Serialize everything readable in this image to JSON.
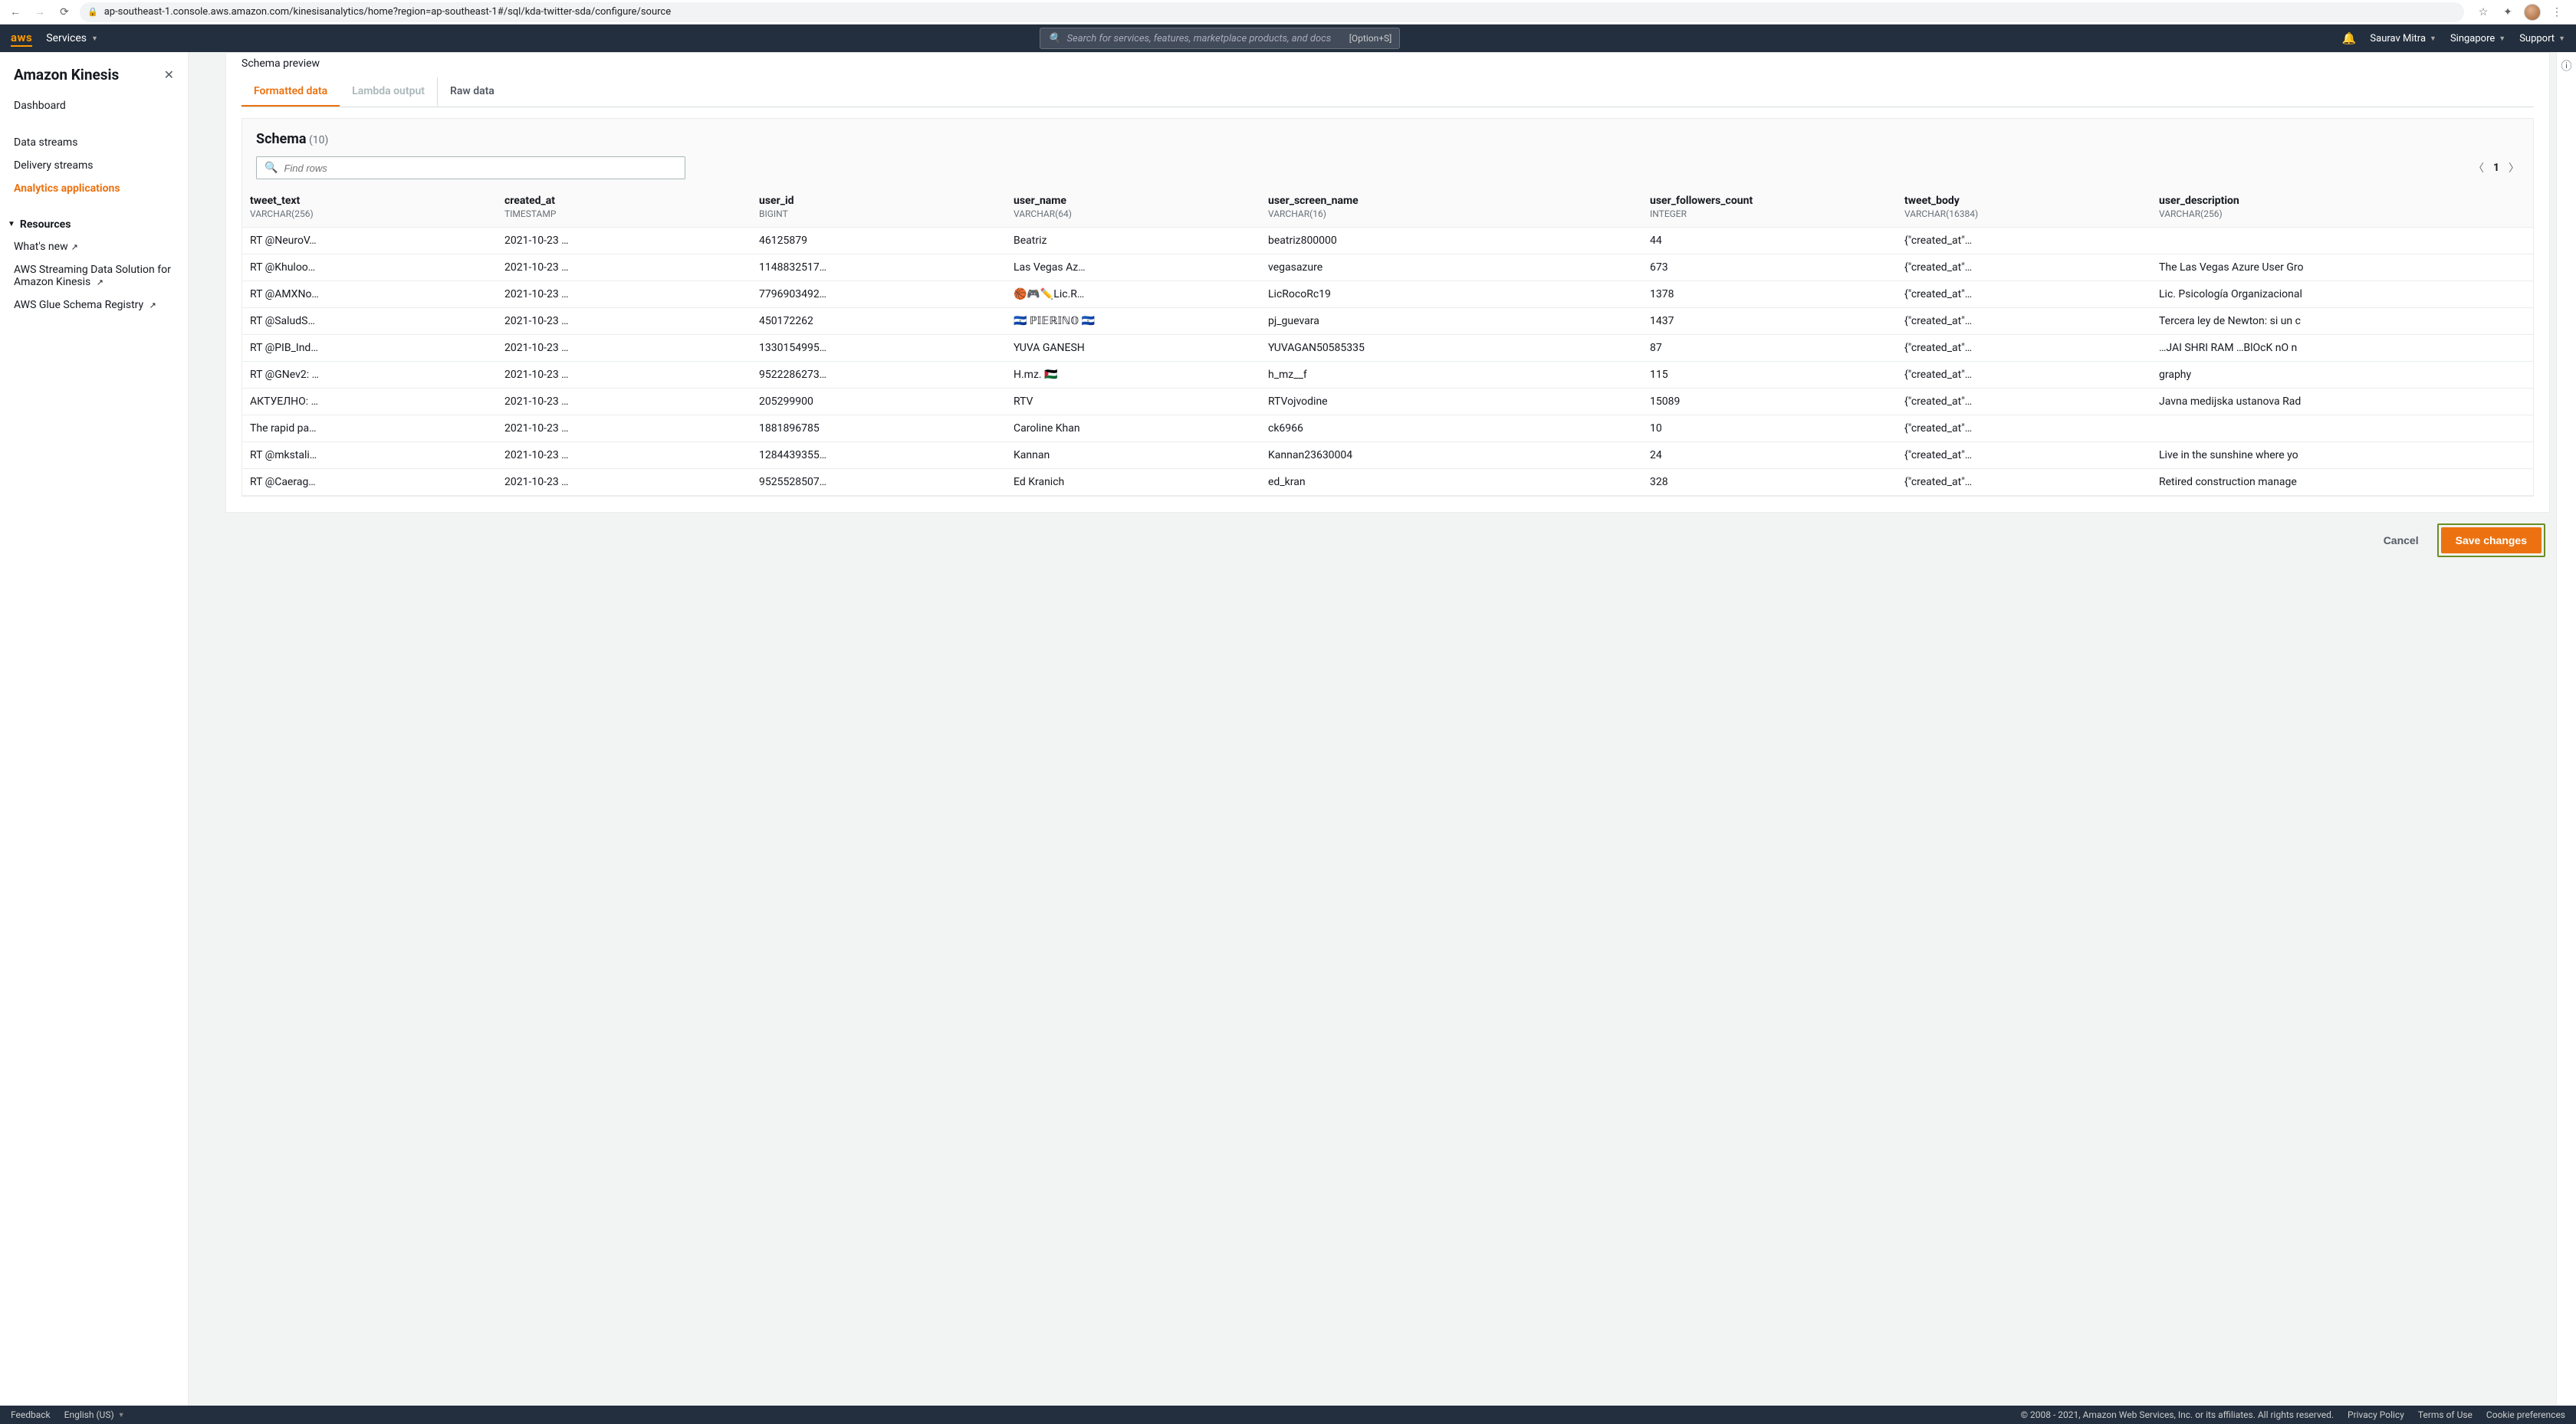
{
  "browser": {
    "url": "ap-southeast-1.console.aws.amazon.com/kinesisanalytics/home?region=ap-southeast-1#/sql/kda-twitter-sda/configure/source"
  },
  "awsnav": {
    "services": "Services",
    "search_placeholder": "Search for services, features, marketplace products, and docs",
    "shortcut": "[Option+S]",
    "user": "Saurav Mitra",
    "region": "Singapore",
    "support": "Support"
  },
  "sidebar": {
    "title": "Amazon Kinesis",
    "links": {
      "dashboard": "Dashboard",
      "data_streams": "Data streams",
      "delivery_streams": "Delivery streams",
      "analytics": "Analytics applications",
      "resources": "Resources",
      "whats_new": "What's new",
      "streaming_solution": "AWS Streaming Data Solution for Amazon Kinesis",
      "glue": "AWS Glue Schema Registry"
    }
  },
  "main": {
    "section_label": "Schema preview",
    "tabs": {
      "formatted": "Formatted data",
      "lambda": "Lambda output",
      "raw": "Raw data"
    },
    "schema_title": "Schema",
    "schema_count": "(10)",
    "find_placeholder": "Find rows",
    "page": "1",
    "columns": [
      {
        "name": "tweet_text",
        "type": "VARCHAR(256)"
      },
      {
        "name": "created_at",
        "type": "TIMESTAMP"
      },
      {
        "name": "user_id",
        "type": "BIGINT"
      },
      {
        "name": "user_name",
        "type": "VARCHAR(64)"
      },
      {
        "name": "user_screen_name",
        "type": "VARCHAR(16)"
      },
      {
        "name": "user_followers_count",
        "type": "INTEGER"
      },
      {
        "name": "tweet_body",
        "type": "VARCHAR(16384)"
      },
      {
        "name": "user_description",
        "type": "VARCHAR(256)"
      }
    ],
    "rows": [
      {
        "c0": "RT @NeuroV…",
        "c1": "2021-10-23 …",
        "c2": "46125879",
        "c3": "Beatriz",
        "c4": "beatriz800000",
        "c5": "44",
        "c6": "{\"created_at\"…",
        "c7": ""
      },
      {
        "c0": "RT @Khuloo…",
        "c1": "2021-10-23 …",
        "c2": "1148832517…",
        "c3": "Las Vegas Az…",
        "c4": "vegasazure",
        "c5": "673",
        "c6": "{\"created_at\"…",
        "c7": "The Las Vegas Azure User Gro"
      },
      {
        "c0": "RT @AMXNo…",
        "c1": "2021-10-23 …",
        "c2": "7796903492…",
        "c3": "🏀🎮✏️Lic.R…",
        "c4": "LicRocoRc19",
        "c5": "1378",
        "c6": "{\"created_at\"…",
        "c7": "Lic. Psicología Organizacional"
      },
      {
        "c0": "RT @SaludS…",
        "c1": "2021-10-23 …",
        "c2": "450172262",
        "c3": "🇸🇻 ℙ𝕀𝔼ℝ𝕀ℕ𝕆 🇸🇻",
        "c4": "pj_guevara",
        "c5": "1437",
        "c6": "{\"created_at\"…",
        "c7": "Tercera ley de Newton: si un c"
      },
      {
        "c0": "RT @PIB_Ind…",
        "c1": "2021-10-23 …",
        "c2": "1330154995…",
        "c3": "YUVA GANESH",
        "c4": "YUVAGAN50585335",
        "c5": "87",
        "c6": "{\"created_at\"…",
        "c7": "…JAI SHRI RAM …BlOcK nO n"
      },
      {
        "c0": "RT @GNev2: …",
        "c1": "2021-10-23 …",
        "c2": "9522286273…",
        "c3": "H.mz. 🇵🇸",
        "c4": "h_mz__f",
        "c5": "115",
        "c6": "{\"created_at\"…",
        "c7": "graphy"
      },
      {
        "c0": "АКТУЕЛНО: …",
        "c1": "2021-10-23 …",
        "c2": "205299900",
        "c3": "RTV",
        "c4": "RTVojvodine",
        "c5": "15089",
        "c6": "{\"created_at\"…",
        "c7": "Javna medijska ustanova Rad"
      },
      {
        "c0": "The rapid pa…",
        "c1": "2021-10-23 …",
        "c2": "1881896785",
        "c3": "Caroline Khan",
        "c4": "ck6966",
        "c5": "10",
        "c6": "{\"created_at\"…",
        "c7": ""
      },
      {
        "c0": "RT @mkstali…",
        "c1": "2021-10-23 …",
        "c2": "1284439355…",
        "c3": "Kannan",
        "c4": "Kannan23630004",
        "c5": "24",
        "c6": "{\"created_at\"…",
        "c7": "Live in the sunshine where yo"
      },
      {
        "c0": "RT @Caerag…",
        "c1": "2021-10-23 …",
        "c2": "9525528507…",
        "c3": "Ed Kranich",
        "c4": "ed_kran",
        "c5": "328",
        "c6": "{\"created_at\"…",
        "c7": "Retired construction manage"
      }
    ],
    "cancel": "Cancel",
    "save": "Save changes"
  },
  "footer": {
    "feedback": "Feedback",
    "lang": "English (US)",
    "copyright": "© 2008 - 2021, Amazon Web Services, Inc. or its affiliates. All rights reserved.",
    "privacy": "Privacy Policy",
    "terms": "Terms of Use",
    "cookies": "Cookie preferences"
  }
}
